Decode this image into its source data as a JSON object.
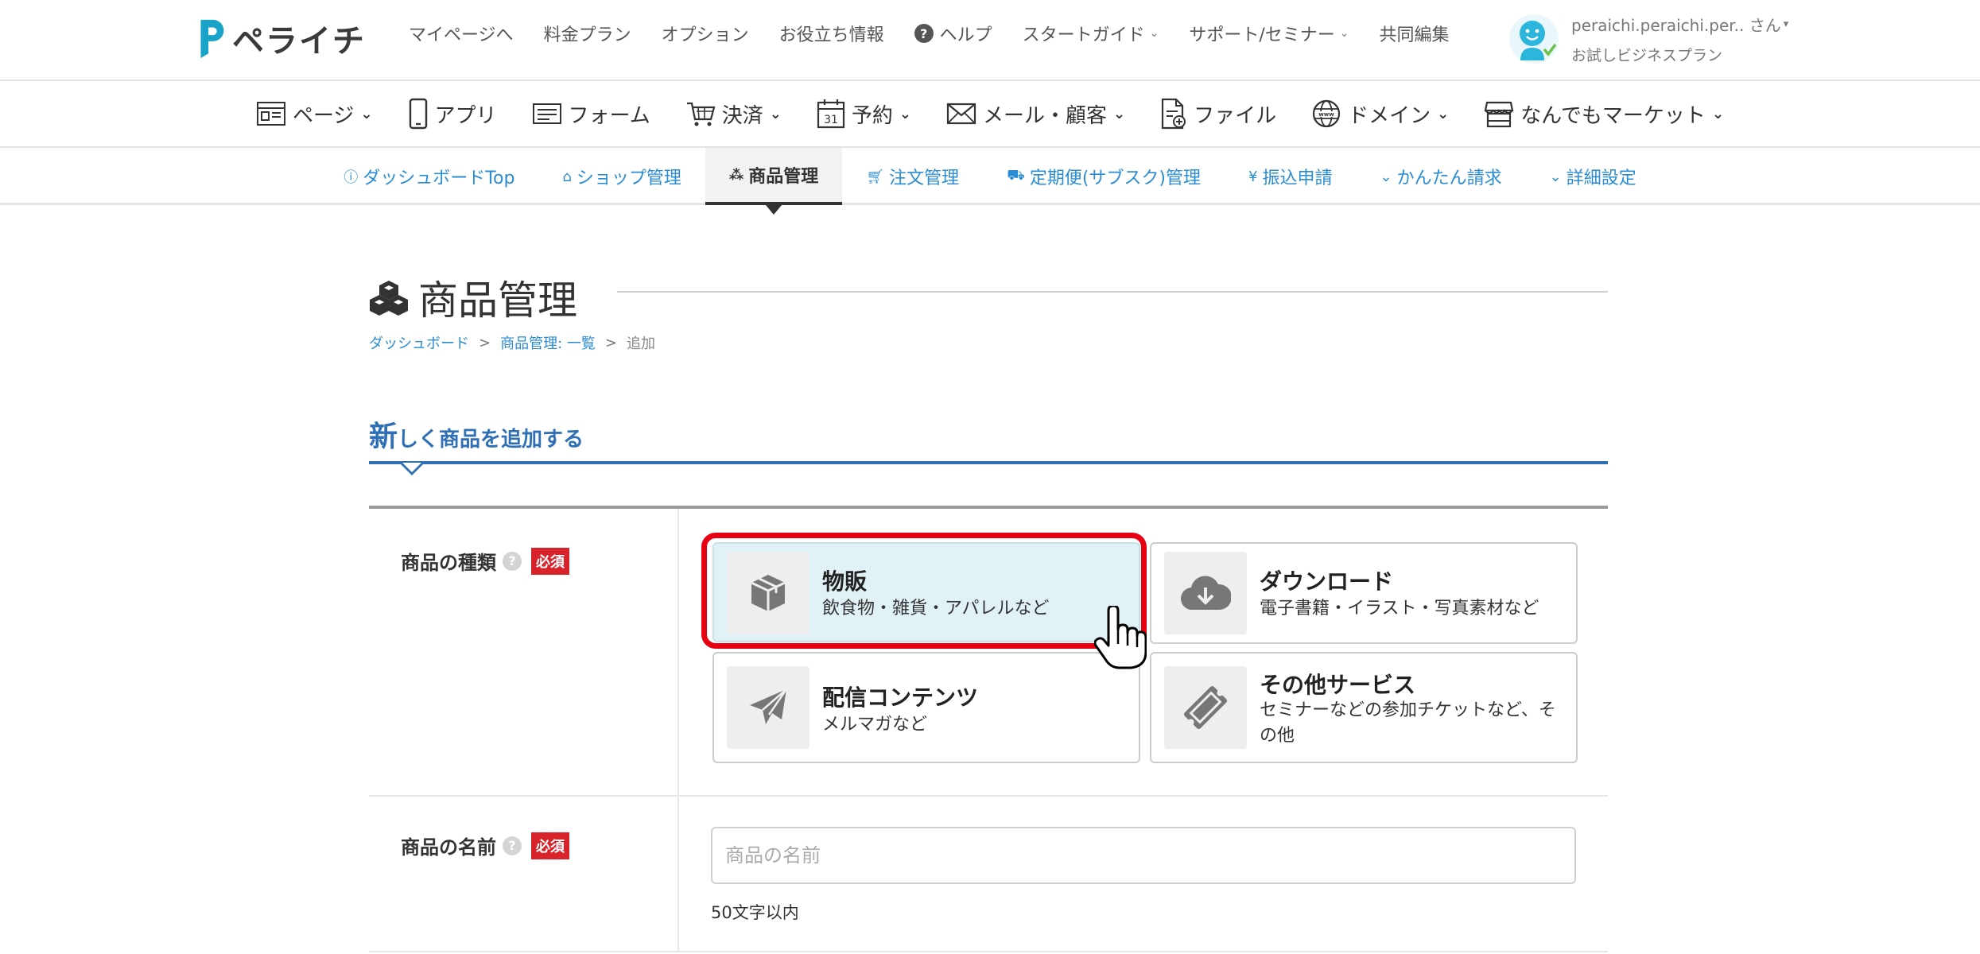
{
  "header": {
    "brand": "ペライチ",
    "nav": [
      {
        "label": "マイページへ",
        "dropdown": false
      },
      {
        "label": "料金プラン",
        "dropdown": false
      },
      {
        "label": "オプション",
        "dropdown": false
      },
      {
        "label": "お役立ち情報",
        "dropdown": false
      },
      {
        "label": "ヘルプ",
        "dropdown": false
      },
      {
        "label": "スタートガイド",
        "dropdown": true
      },
      {
        "label": "サポート/セミナー",
        "dropdown": true
      },
      {
        "label": "共同編集",
        "dropdown": false
      }
    ],
    "user": {
      "name": "peraichi.peraichi.per.. さん",
      "plan": "お試しビジネスプラン"
    }
  },
  "category_nav": [
    {
      "label": "ページ",
      "icon": "page-icon",
      "dropdown": true
    },
    {
      "label": "アプリ",
      "icon": "smartphone-icon",
      "dropdown": false
    },
    {
      "label": "フォーム",
      "icon": "form-icon",
      "dropdown": false
    },
    {
      "label": "決済",
      "icon": "cart-icon",
      "dropdown": true
    },
    {
      "label": "予約",
      "icon": "calendar-icon",
      "dropdown": true
    },
    {
      "label": "メール・顧客",
      "icon": "mail-icon",
      "dropdown": true
    },
    {
      "label": "ファイル",
      "icon": "file-icon",
      "dropdown": false
    },
    {
      "label": "ドメイン",
      "icon": "globe-icon",
      "dropdown": true
    },
    {
      "label": "なんでもマーケット",
      "icon": "store-icon",
      "dropdown": true
    }
  ],
  "calendar_icon_day": "31",
  "sub_nav": [
    {
      "label": "ダッシュボードTop",
      "icon": "info-icon",
      "active": false
    },
    {
      "label": "ショップ管理",
      "icon": "home-icon",
      "active": false
    },
    {
      "label": "商品管理",
      "icon": "cubes-icon",
      "active": true
    },
    {
      "label": "注文管理",
      "icon": "cart-icon",
      "active": false
    },
    {
      "label": "定期便(サブスク)管理",
      "icon": "truck-icon",
      "active": false
    },
    {
      "label": "振込申請",
      "icon": "yen-icon",
      "active": false
    },
    {
      "label": "かんたん請求",
      "icon": "chevron-down-icon",
      "active": false
    },
    {
      "label": "詳細設定",
      "icon": "chevron-down-icon",
      "active": false
    }
  ],
  "page": {
    "title": "商品管理",
    "breadcrumb": [
      {
        "label": "ダッシュボード",
        "link": true
      },
      {
        "label": "商品管理: 一覧",
        "link": true
      },
      {
        "label": "追加",
        "link": false
      }
    ],
    "breadcrumb_sep": ">",
    "section_first_char": "新",
    "section_rest": "しく商品を追加する"
  },
  "form": {
    "required_badge": "必須",
    "help_glyph": "?",
    "product_type": {
      "label": "商品の種類",
      "options": [
        {
          "title": "物販",
          "desc": "飲食物・雑貨・アパレルなど",
          "icon": "box-icon",
          "selected": true
        },
        {
          "title": "ダウンロード",
          "desc": "電子書籍・イラスト・写真素材など",
          "icon": "cloud-download-icon",
          "selected": false
        },
        {
          "title": "配信コンテンツ",
          "desc": "メルマガなど",
          "icon": "paper-plane-icon",
          "selected": false
        },
        {
          "title": "その他サービス",
          "desc": "セミナーなどの参加チケットなど、その他",
          "icon": "ticket-icon",
          "selected": false
        }
      ]
    },
    "product_name": {
      "label": "商品の名前",
      "value": "",
      "placeholder": "商品の名前",
      "hint": "50文字以内"
    }
  },
  "colors": {
    "accent_blue": "#2f6fb5",
    "link_blue": "#2a8dd4",
    "required_red": "#d9232a",
    "highlight_red": "#e60012",
    "selected_bg": "#e1f2f7",
    "brand_teal": "#1aa3c8"
  }
}
